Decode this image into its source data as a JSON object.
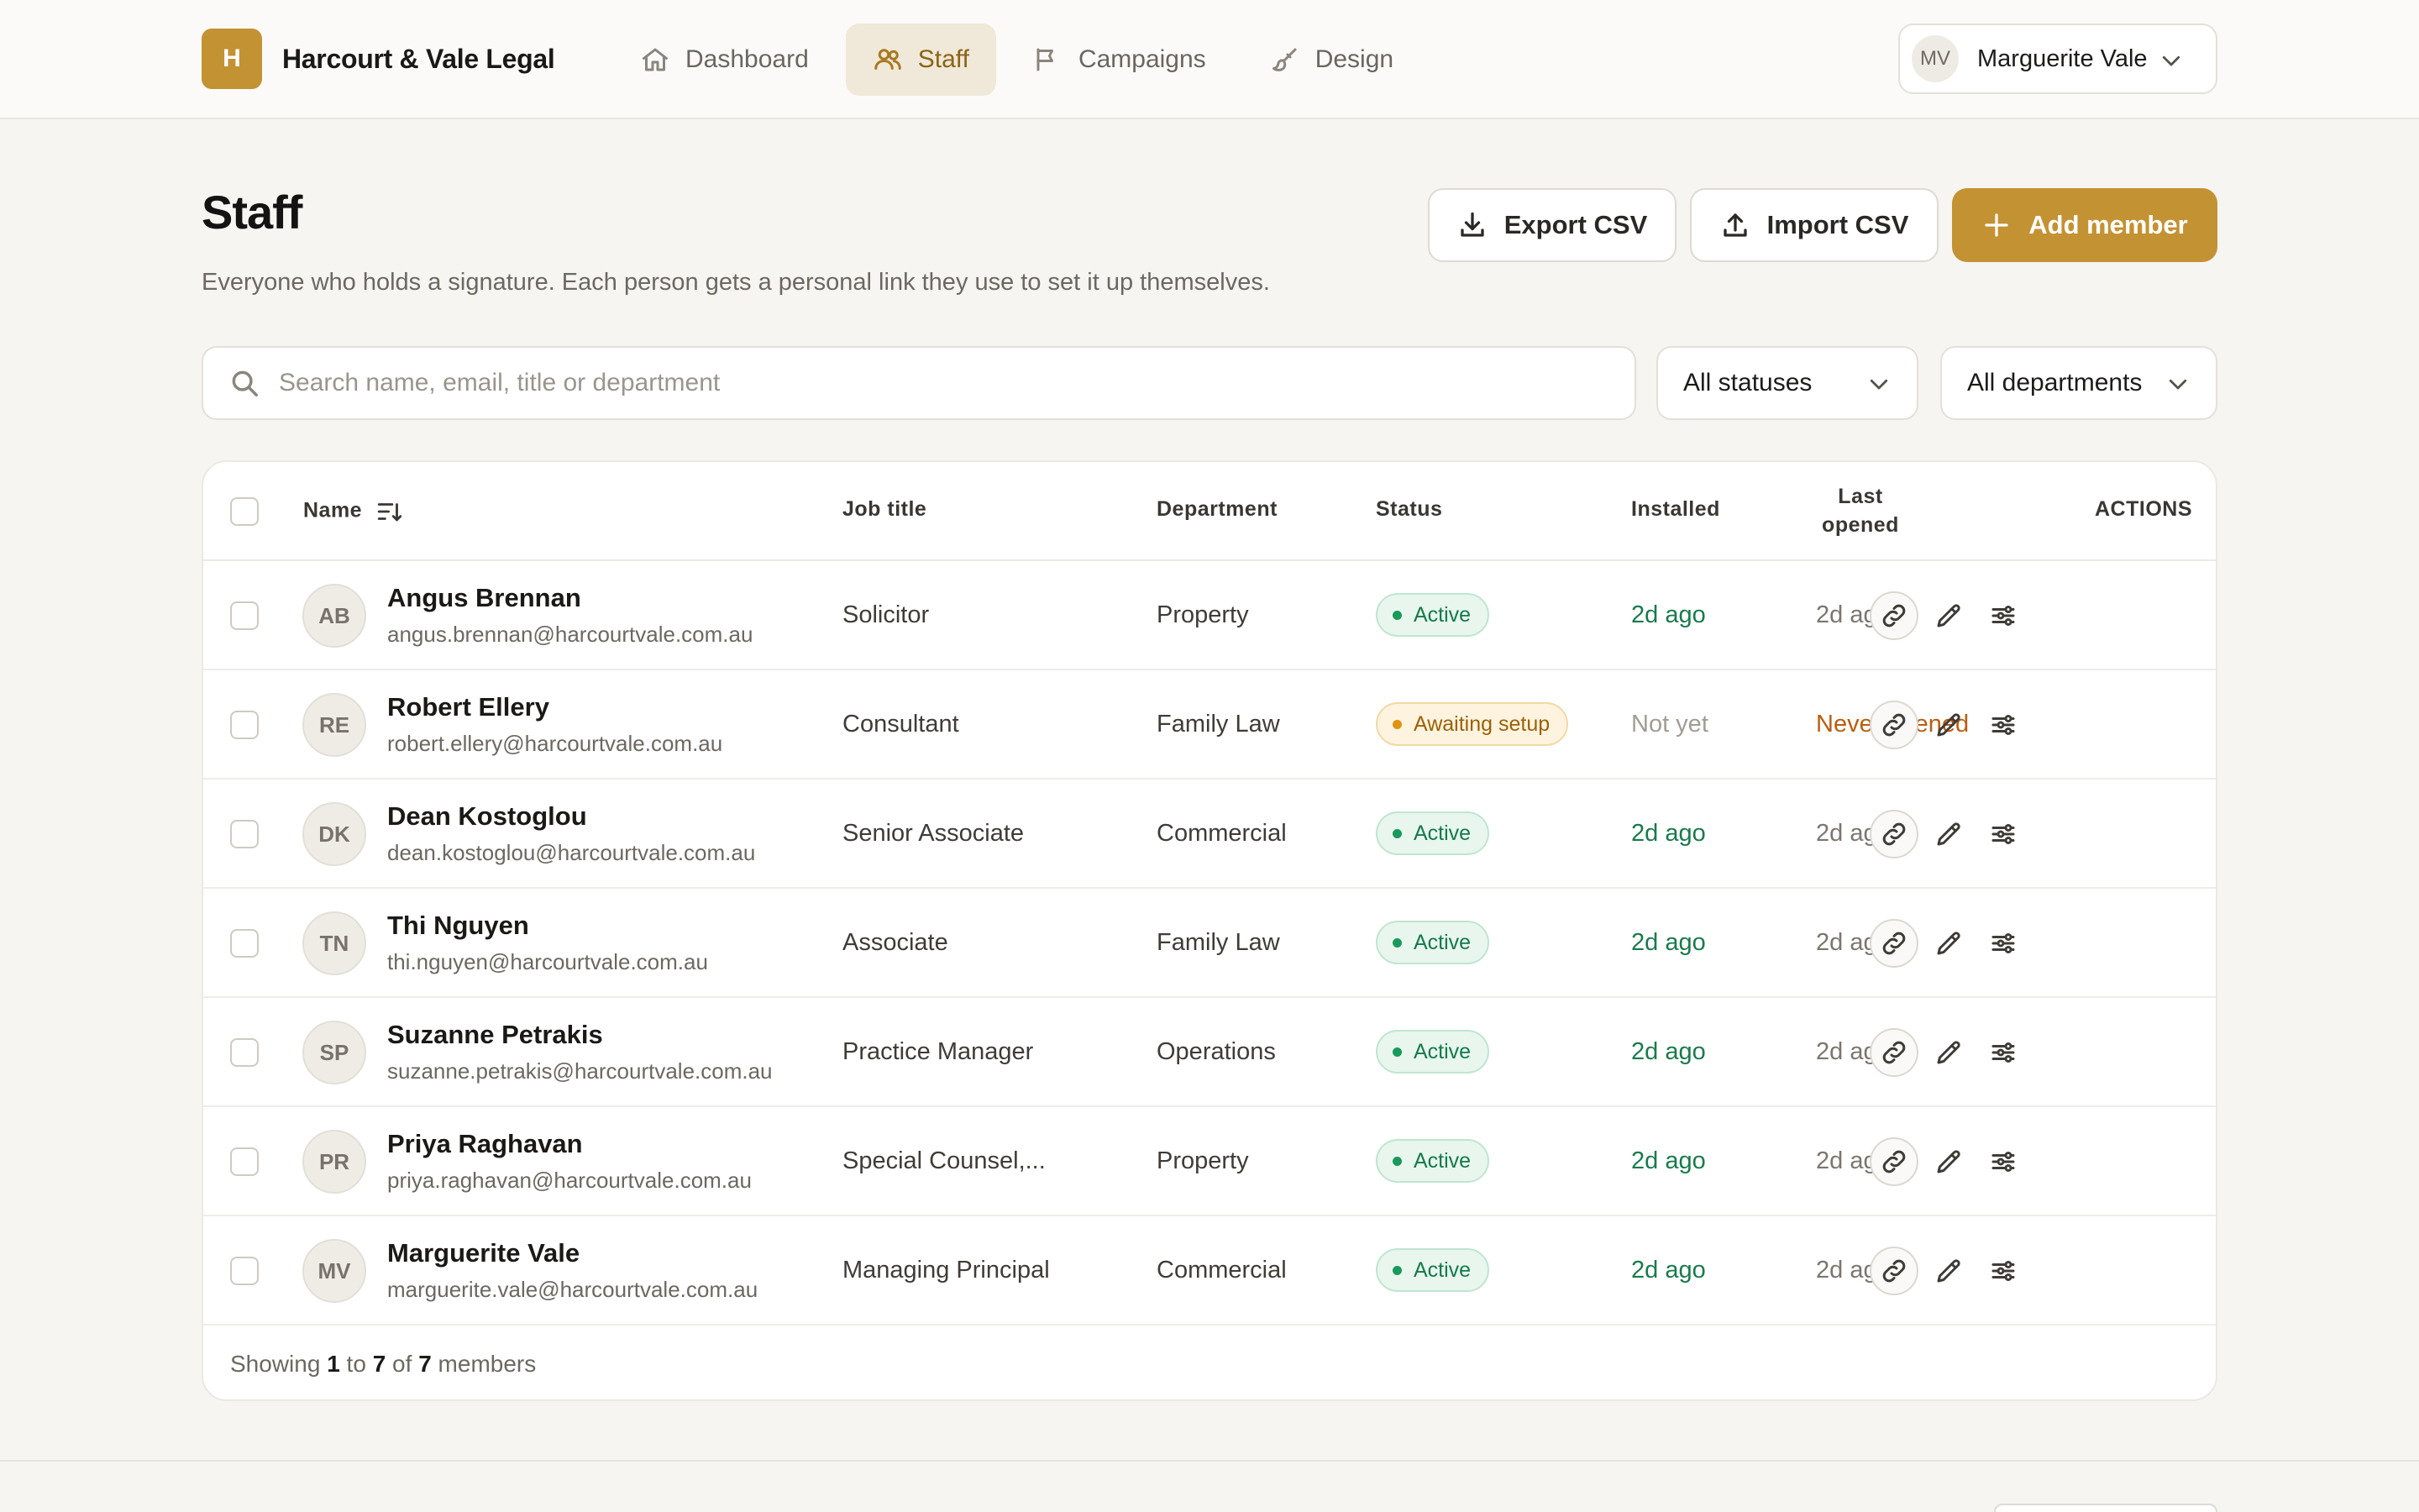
{
  "app": {
    "logo_letter": "H",
    "name": "Harcourt & Vale Legal"
  },
  "nav": {
    "items": [
      {
        "label": "Dashboard",
        "icon": "home-icon",
        "active": false
      },
      {
        "label": "Staff",
        "icon": "users-icon",
        "active": true
      },
      {
        "label": "Campaigns",
        "icon": "megaphone-icon",
        "active": false
      },
      {
        "label": "Design",
        "icon": "brush-icon",
        "active": false
      }
    ]
  },
  "user": {
    "initials": "MV",
    "name": "Marguerite Vale"
  },
  "page": {
    "title": "Staff",
    "subtitle": "Everyone who holds a signature. Each person gets a personal link they use to set it up themselves."
  },
  "actions": {
    "export_label": "Export CSV",
    "import_label": "Import CSV",
    "add_label": "Add member"
  },
  "filters": {
    "search_placeholder": "Search name, email, title or department",
    "status_value": "All statuses",
    "department_value": "All departments"
  },
  "table": {
    "headers": {
      "name": "Name",
      "job_title": "Job title",
      "department": "Department",
      "status": "Status",
      "installed": "Installed",
      "last_opened_1": "Last",
      "last_opened_2": "opened",
      "actions": "ACTIONS"
    },
    "rows": [
      {
        "initials": "AB",
        "name": "Angus Brennan",
        "email": "angus.brennan@harcourtvale.com.au",
        "job_title": "Solicitor",
        "department": "Property",
        "status": "Active",
        "status_kind": "active",
        "installed": "2d ago",
        "installed_kind": "ok",
        "last_opened": "2d ago",
        "opened_kind": "ok"
      },
      {
        "initials": "RE",
        "name": "Robert Ellery",
        "email": "robert.ellery@harcourtvale.com.au",
        "job_title": "Consultant",
        "department": "Family Law",
        "status": "Awaiting setup",
        "status_kind": "pending",
        "installed": "Not yet",
        "installed_kind": "no",
        "last_opened": "Never opened",
        "opened_kind": "never"
      },
      {
        "initials": "DK",
        "name": "Dean Kostoglou",
        "email": "dean.kostoglou@harcourtvale.com.au",
        "job_title": "Senior Associate",
        "department": "Commercial",
        "status": "Active",
        "status_kind": "active",
        "installed": "2d ago",
        "installed_kind": "ok",
        "last_opened": "2d ago",
        "opened_kind": "ok"
      },
      {
        "initials": "TN",
        "name": "Thi Nguyen",
        "email": "thi.nguyen@harcourtvale.com.au",
        "job_title": "Associate",
        "department": "Family Law",
        "status": "Active",
        "status_kind": "active",
        "installed": "2d ago",
        "installed_kind": "ok",
        "last_opened": "2d ago",
        "opened_kind": "ok"
      },
      {
        "initials": "SP",
        "name": "Suzanne Petrakis",
        "email": "suzanne.petrakis@harcourtvale.com.au",
        "job_title": "Practice Manager",
        "department": "Operations",
        "status": "Active",
        "status_kind": "active",
        "installed": "2d ago",
        "installed_kind": "ok",
        "last_opened": "2d ago",
        "opened_kind": "ok"
      },
      {
        "initials": "PR",
        "name": "Priya Raghavan",
        "email": "priya.raghavan@harcourtvale.com.au",
        "job_title": "Special Counsel,...",
        "department": "Property",
        "status": "Active",
        "status_kind": "active",
        "installed": "2d ago",
        "installed_kind": "ok",
        "last_opened": "2d ago",
        "opened_kind": "ok"
      },
      {
        "initials": "MV",
        "name": "Marguerite Vale",
        "email": "marguerite.vale@harcourtvale.com.au",
        "job_title": "Managing Principal",
        "department": "Commercial",
        "status": "Active",
        "status_kind": "active",
        "installed": "2d ago",
        "installed_kind": "ok",
        "last_opened": "2d ago",
        "opened_kind": "ok"
      }
    ],
    "footer": {
      "prefix": "Showing",
      "from": "1",
      "to_word": "to",
      "to": "7",
      "of_word": "of",
      "total": "7",
      "suffix": "members"
    }
  }
}
